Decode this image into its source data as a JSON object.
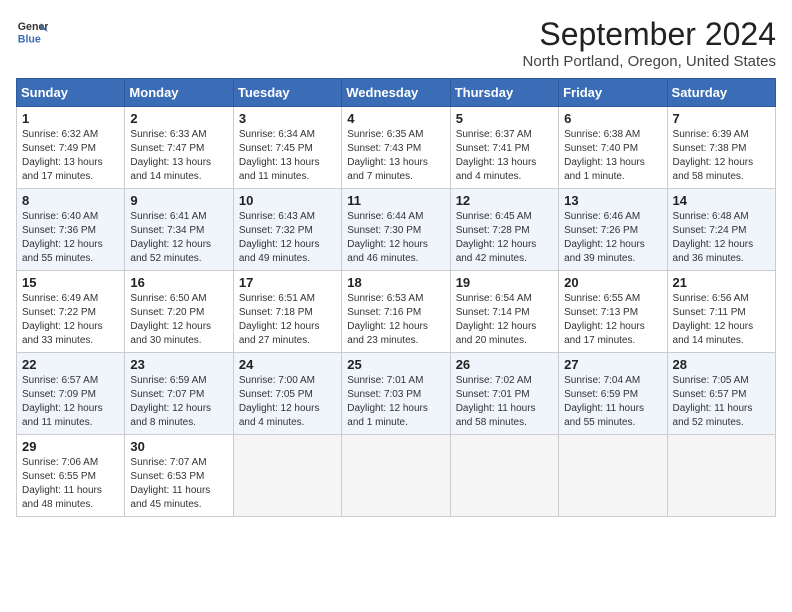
{
  "header": {
    "logo_line1": "General",
    "logo_line2": "Blue",
    "month": "September 2024",
    "location": "North Portland, Oregon, United States"
  },
  "weekdays": [
    "Sunday",
    "Monday",
    "Tuesday",
    "Wednesday",
    "Thursday",
    "Friday",
    "Saturday"
  ],
  "weeks": [
    [
      {
        "day": "1",
        "sunrise": "6:32 AM",
        "sunset": "7:49 PM",
        "daylight": "13 hours and 17 minutes."
      },
      {
        "day": "2",
        "sunrise": "6:33 AM",
        "sunset": "7:47 PM",
        "daylight": "13 hours and 14 minutes."
      },
      {
        "day": "3",
        "sunrise": "6:34 AM",
        "sunset": "7:45 PM",
        "daylight": "13 hours and 11 minutes."
      },
      {
        "day": "4",
        "sunrise": "6:35 AM",
        "sunset": "7:43 PM",
        "daylight": "13 hours and 7 minutes."
      },
      {
        "day": "5",
        "sunrise": "6:37 AM",
        "sunset": "7:41 PM",
        "daylight": "13 hours and 4 minutes."
      },
      {
        "day": "6",
        "sunrise": "6:38 AM",
        "sunset": "7:40 PM",
        "daylight": "13 hours and 1 minute."
      },
      {
        "day": "7",
        "sunrise": "6:39 AM",
        "sunset": "7:38 PM",
        "daylight": "12 hours and 58 minutes."
      }
    ],
    [
      {
        "day": "8",
        "sunrise": "6:40 AM",
        "sunset": "7:36 PM",
        "daylight": "12 hours and 55 minutes."
      },
      {
        "day": "9",
        "sunrise": "6:41 AM",
        "sunset": "7:34 PM",
        "daylight": "12 hours and 52 minutes."
      },
      {
        "day": "10",
        "sunrise": "6:43 AM",
        "sunset": "7:32 PM",
        "daylight": "12 hours and 49 minutes."
      },
      {
        "day": "11",
        "sunrise": "6:44 AM",
        "sunset": "7:30 PM",
        "daylight": "12 hours and 46 minutes."
      },
      {
        "day": "12",
        "sunrise": "6:45 AM",
        "sunset": "7:28 PM",
        "daylight": "12 hours and 42 minutes."
      },
      {
        "day": "13",
        "sunrise": "6:46 AM",
        "sunset": "7:26 PM",
        "daylight": "12 hours and 39 minutes."
      },
      {
        "day": "14",
        "sunrise": "6:48 AM",
        "sunset": "7:24 PM",
        "daylight": "12 hours and 36 minutes."
      }
    ],
    [
      {
        "day": "15",
        "sunrise": "6:49 AM",
        "sunset": "7:22 PM",
        "daylight": "12 hours and 33 minutes."
      },
      {
        "day": "16",
        "sunrise": "6:50 AM",
        "sunset": "7:20 PM",
        "daylight": "12 hours and 30 minutes."
      },
      {
        "day": "17",
        "sunrise": "6:51 AM",
        "sunset": "7:18 PM",
        "daylight": "12 hours and 27 minutes."
      },
      {
        "day": "18",
        "sunrise": "6:53 AM",
        "sunset": "7:16 PM",
        "daylight": "12 hours and 23 minutes."
      },
      {
        "day": "19",
        "sunrise": "6:54 AM",
        "sunset": "7:14 PM",
        "daylight": "12 hours and 20 minutes."
      },
      {
        "day": "20",
        "sunrise": "6:55 AM",
        "sunset": "7:13 PM",
        "daylight": "12 hours and 17 minutes."
      },
      {
        "day": "21",
        "sunrise": "6:56 AM",
        "sunset": "7:11 PM",
        "daylight": "12 hours and 14 minutes."
      }
    ],
    [
      {
        "day": "22",
        "sunrise": "6:57 AM",
        "sunset": "7:09 PM",
        "daylight": "12 hours and 11 minutes."
      },
      {
        "day": "23",
        "sunrise": "6:59 AM",
        "sunset": "7:07 PM",
        "daylight": "12 hours and 8 minutes."
      },
      {
        "day": "24",
        "sunrise": "7:00 AM",
        "sunset": "7:05 PM",
        "daylight": "12 hours and 4 minutes."
      },
      {
        "day": "25",
        "sunrise": "7:01 AM",
        "sunset": "7:03 PM",
        "daylight": "12 hours and 1 minute."
      },
      {
        "day": "26",
        "sunrise": "7:02 AM",
        "sunset": "7:01 PM",
        "daylight": "11 hours and 58 minutes."
      },
      {
        "day": "27",
        "sunrise": "7:04 AM",
        "sunset": "6:59 PM",
        "daylight": "11 hours and 55 minutes."
      },
      {
        "day": "28",
        "sunrise": "7:05 AM",
        "sunset": "6:57 PM",
        "daylight": "11 hours and 52 minutes."
      }
    ],
    [
      {
        "day": "29",
        "sunrise": "7:06 AM",
        "sunset": "6:55 PM",
        "daylight": "11 hours and 48 minutes."
      },
      {
        "day": "30",
        "sunrise": "7:07 AM",
        "sunset": "6:53 PM",
        "daylight": "11 hours and 45 minutes."
      },
      null,
      null,
      null,
      null,
      null
    ]
  ]
}
